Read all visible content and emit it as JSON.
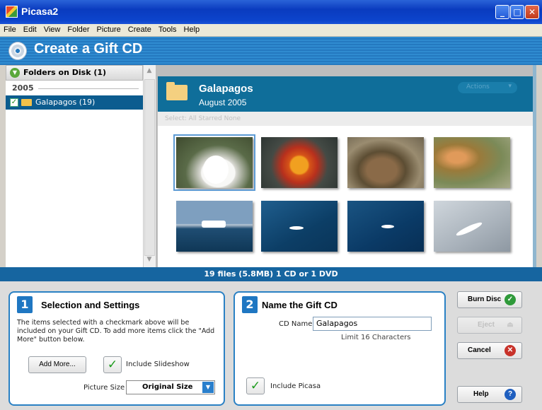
{
  "window": {
    "title": "Picasa2"
  },
  "menu": [
    "File",
    "Edit",
    "View",
    "Folder",
    "Picture",
    "Create",
    "Tools",
    "Help"
  ],
  "header": {
    "title": "Create a Gift CD"
  },
  "sidebar": {
    "header": "Folders on Disk (1)",
    "year": "2005",
    "folder": {
      "label": "Galapagos (19)",
      "checked": true
    }
  },
  "album": {
    "name": "Galapagos",
    "date": "August 2005",
    "actions_label": "Actions",
    "select_row": "Select:  All  Starred  None"
  },
  "thumbnails": [
    {
      "icon": "frigatebird-chick-photo"
    },
    {
      "icon": "sally-lightfoot-crab-photo"
    },
    {
      "icon": "land-iguana-photo"
    },
    {
      "icon": "cactus-photo"
    },
    {
      "icon": "boat-at-sea-photo"
    },
    {
      "icon": "tropicbird-over-water-photo"
    },
    {
      "icon": "tropicbird-flying-photo"
    },
    {
      "icon": "tropicbird-sky-photo"
    }
  ],
  "status": {
    "text": "19 files (5.8MB) 1 CD or 1 DVD"
  },
  "step1": {
    "number": "1",
    "title": "Selection and Settings",
    "description": "The items selected with a checkmark above will be included on your Gift CD.  To add more items click the \"Add More\" button below.",
    "add_more_label": "Add More...",
    "include_slideshow_label": "Include Slideshow",
    "include_slideshow_checked": true,
    "picture_size_label": "Picture Size",
    "picture_size_value": "Original Size"
  },
  "step2": {
    "number": "2",
    "title": "Name the Gift CD",
    "cd_name_label": "CD Name",
    "cd_name_value": "Galapagos",
    "limit_text": "Limit 16 Characters",
    "include_picasa_label": "Include Picasa",
    "include_picasa_checked": true
  },
  "buttons": {
    "burn": "Burn Disc",
    "eject": "Eject",
    "cancel": "Cancel",
    "help": "Help"
  },
  "colors": {
    "header_blue": "#2479c0",
    "album_header": "#0f6e9a",
    "status_blue": "#1665a0",
    "card_border": "#2a81c4"
  }
}
